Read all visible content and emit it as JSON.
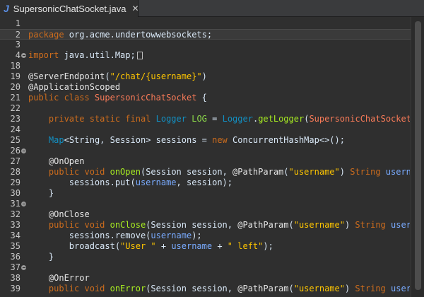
{
  "tab": {
    "icon": "java-file-icon",
    "icon_glyph": "J",
    "title": "SupersonicChatSocket.java",
    "close_glyph": "✕"
  },
  "editor": {
    "lines": [
      {
        "num": "1",
        "fold": false,
        "current": false,
        "tokens": []
      },
      {
        "num": "2",
        "fold": false,
        "current": true,
        "tokens": [
          [
            "kw",
            "package"
          ],
          [
            "plain",
            " org.acme.undertowwebsockets;"
          ]
        ]
      },
      {
        "num": "3",
        "fold": false,
        "current": false,
        "tokens": []
      },
      {
        "num": "4",
        "fold": true,
        "current": false,
        "folded": true,
        "tokens": [
          [
            "kw",
            "import"
          ],
          [
            "plain",
            " java.util.Map;"
          ]
        ]
      },
      {
        "num": "18",
        "fold": false,
        "current": false,
        "tokens": []
      },
      {
        "num": "19",
        "fold": false,
        "current": false,
        "tokens": [
          [
            "ann",
            "@ServerEndpoint"
          ],
          [
            "plain",
            "("
          ],
          [
            "str",
            "\"/chat/{username}\""
          ],
          [
            "plain",
            ")"
          ]
        ]
      },
      {
        "num": "20",
        "fold": false,
        "current": false,
        "tokens": [
          [
            "ann",
            "@ApplicationScoped"
          ]
        ]
      },
      {
        "num": "21",
        "fold": false,
        "current": false,
        "tokens": [
          [
            "kw",
            "public class "
          ],
          [
            "cls",
            "SupersonicChatSocket"
          ],
          [
            "plain",
            " {"
          ]
        ]
      },
      {
        "num": "22",
        "fold": false,
        "current": false,
        "tokens": []
      },
      {
        "num": "23",
        "fold": false,
        "current": false,
        "tokens": [
          [
            "plain",
            "    "
          ],
          [
            "kw",
            "private static final "
          ],
          [
            "type",
            "Logger"
          ],
          [
            "plain",
            " "
          ],
          [
            "const",
            "LOG"
          ],
          [
            "plain",
            " = "
          ],
          [
            "type",
            "Logger"
          ],
          [
            "plain",
            "."
          ],
          [
            "fn",
            "getLogger"
          ],
          [
            "plain",
            "("
          ],
          [
            "cls",
            "SupersonicChatSocket"
          ],
          [
            "plain",
            ".c"
          ]
        ]
      },
      {
        "num": "24",
        "fold": false,
        "current": false,
        "tokens": []
      },
      {
        "num": "25",
        "fold": false,
        "current": false,
        "tokens": [
          [
            "plain",
            "    "
          ],
          [
            "type",
            "Map"
          ],
          [
            "plain",
            "<String, Session> sessions = "
          ],
          [
            "kw",
            "new"
          ],
          [
            "plain",
            " ConcurrentHashMap<>();"
          ]
        ]
      },
      {
        "num": "26",
        "fold": true,
        "current": false,
        "tokens": []
      },
      {
        "num": "27",
        "fold": false,
        "current": false,
        "tokens": [
          [
            "ann",
            "    @OnOpen"
          ]
        ]
      },
      {
        "num": "28",
        "fold": false,
        "current": false,
        "tokens": [
          [
            "plain",
            "    "
          ],
          [
            "kw",
            "public void "
          ],
          [
            "fn",
            "onOpen"
          ],
          [
            "plain",
            "(Session session, "
          ],
          [
            "ann",
            "@PathParam"
          ],
          [
            "plain",
            "("
          ],
          [
            "str",
            "\"username\""
          ],
          [
            "plain",
            ") "
          ],
          [
            "kw",
            "String "
          ],
          [
            "id",
            "userna"
          ]
        ]
      },
      {
        "num": "29",
        "fold": false,
        "current": false,
        "tokens": [
          [
            "plain",
            "        sessions.put("
          ],
          [
            "id",
            "username"
          ],
          [
            "plain",
            ", session);"
          ]
        ]
      },
      {
        "num": "30",
        "fold": false,
        "current": false,
        "tokens": [
          [
            "plain",
            "    }"
          ]
        ]
      },
      {
        "num": "31",
        "fold": true,
        "current": false,
        "tokens": []
      },
      {
        "num": "32",
        "fold": false,
        "current": false,
        "tokens": [
          [
            "ann",
            "    @OnClose"
          ]
        ]
      },
      {
        "num": "33",
        "fold": false,
        "current": false,
        "tokens": [
          [
            "plain",
            "    "
          ],
          [
            "kw",
            "public void "
          ],
          [
            "fn",
            "onClose"
          ],
          [
            "plain",
            "(Session session, "
          ],
          [
            "ann",
            "@PathParam"
          ],
          [
            "plain",
            "("
          ],
          [
            "str",
            "\"username\""
          ],
          [
            "plain",
            ") "
          ],
          [
            "kw",
            "String "
          ],
          [
            "id",
            "userna"
          ]
        ]
      },
      {
        "num": "34",
        "fold": false,
        "current": false,
        "tokens": [
          [
            "plain",
            "        sessions.remove("
          ],
          [
            "id",
            "username"
          ],
          [
            "plain",
            ");"
          ]
        ]
      },
      {
        "num": "35",
        "fold": false,
        "current": false,
        "tokens": [
          [
            "plain",
            "        broadcast("
          ],
          [
            "str",
            "\"User \""
          ],
          [
            "plain",
            " + "
          ],
          [
            "id",
            "username"
          ],
          [
            "plain",
            " + "
          ],
          [
            "str",
            "\" left\""
          ],
          [
            "plain",
            ");"
          ]
        ]
      },
      {
        "num": "36",
        "fold": false,
        "current": false,
        "tokens": [
          [
            "plain",
            "    }"
          ]
        ]
      },
      {
        "num": "37",
        "fold": true,
        "current": false,
        "tokens": []
      },
      {
        "num": "38",
        "fold": false,
        "current": false,
        "tokens": [
          [
            "ann",
            "    @OnError"
          ]
        ]
      },
      {
        "num": "39",
        "fold": false,
        "current": false,
        "tokens": [
          [
            "plain",
            "    "
          ],
          [
            "kw",
            "public void "
          ],
          [
            "fn",
            "onError"
          ],
          [
            "plain",
            "(Session session, "
          ],
          [
            "ann",
            "@PathParam"
          ],
          [
            "plain",
            "("
          ],
          [
            "str",
            "\"username\""
          ],
          [
            "plain",
            ") "
          ],
          [
            "kw",
            "String "
          ],
          [
            "id",
            "userna"
          ]
        ]
      }
    ]
  },
  "colors": {
    "background": "#2f2f2f",
    "keyword": "#cc6c1d",
    "type": "#1290c3",
    "string": "#ffc600",
    "method": "#a7ec21",
    "constant": "#8dda4b",
    "class": "#f97b58"
  }
}
